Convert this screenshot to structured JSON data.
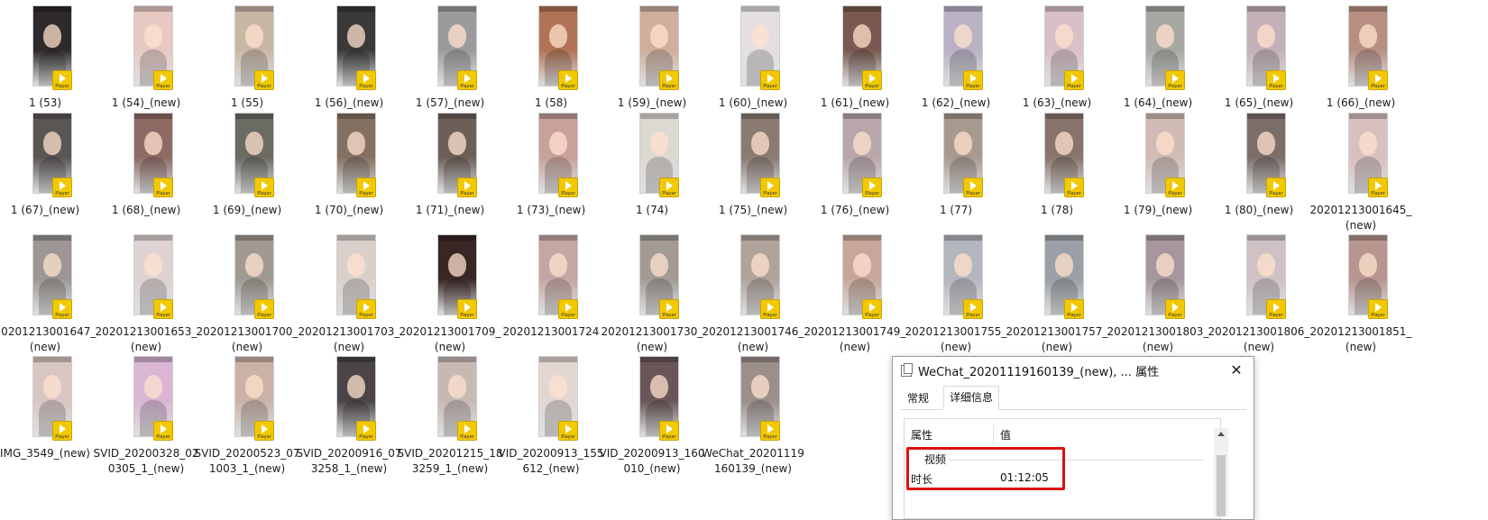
{
  "files": [
    {
      "name": "1 (53)",
      "thumb": "#2e2a2c"
    },
    {
      "name": "1 (54)_(new)",
      "thumb": "#e7c9c4"
    },
    {
      "name": "1 (55)",
      "thumb": "#c9b7a5"
    },
    {
      "name": "1 (56)_(new)",
      "thumb": "#3b3838"
    },
    {
      "name": "1 (57)_(new)",
      "thumb": "#9c9a9c"
    },
    {
      "name": "1 (58)",
      "thumb": "#b07355"
    },
    {
      "name": "1 (59)_(new)",
      "thumb": "#cfae9c"
    },
    {
      "name": "1 (60)_(new)",
      "thumb": "#e3dfe2"
    },
    {
      "name": "1 (61)_(new)",
      "thumb": "#7a5a50"
    },
    {
      "name": "1 (62)_(new)",
      "thumb": "#b9b2c4"
    },
    {
      "name": "1 (63)_(new)",
      "thumb": "#d8c0c6"
    },
    {
      "name": "1 (64)_(new)",
      "thumb": "#a7a7a3"
    },
    {
      "name": "1 (65)_(new)",
      "thumb": "#c4b0b8"
    },
    {
      "name": "1 (66)_(new)",
      "thumb": "#b88f82"
    },
    {
      "name": "1 (67)_(new)",
      "thumb": "#5a5654"
    },
    {
      "name": "1 (68)_(new)",
      "thumb": "#8e6a64"
    },
    {
      "name": "1 (69)_(new)",
      "thumb": "#6b6a63"
    },
    {
      "name": "1 (70)_(new)",
      "thumb": "#857161"
    },
    {
      "name": "1 (71)_(new)",
      "thumb": "#6c5f58"
    },
    {
      "name": "1 (73)_(new)",
      "thumb": "#c7a19a"
    },
    {
      "name": "1 (74)",
      "thumb": "#dcd8d2"
    },
    {
      "name": "1 (75)_(new)",
      "thumb": "#8a7a72"
    },
    {
      "name": "1 (76)_(new)",
      "thumb": "#b9a6ab"
    },
    {
      "name": "1 (77)",
      "thumb": "#a8998f"
    },
    {
      "name": "1 (78)",
      "thumb": "#88746b"
    },
    {
      "name": "1 (79)_(new)",
      "thumb": "#d1bcb5"
    },
    {
      "name": "1 (80)_(new)",
      "thumb": "#7b6e69"
    },
    {
      "name": "20201213001645_(new)",
      "thumb": "#d8bfc0"
    },
    {
      "name": "20201213001647_(new)",
      "thumb": "#9c9794"
    },
    {
      "name": "20201213001653_(new)",
      "thumb": "#ddd3d2"
    },
    {
      "name": "20201213001700_(new)",
      "thumb": "#a09a92"
    },
    {
      "name": "20201213001703_(new)",
      "thumb": "#d9d0cc"
    },
    {
      "name": "20201213001709_(new)",
      "thumb": "#3a2624"
    },
    {
      "name": "20201213001724",
      "thumb": "#c6a6a2"
    },
    {
      "name": "20201213001730_(new)",
      "thumb": "#a19b94"
    },
    {
      "name": "20201213001746_(new)",
      "thumb": "#b0a39c"
    },
    {
      "name": "20201213001749_(new)",
      "thumb": "#c7a79a"
    },
    {
      "name": "20201213001755_(new)",
      "thumb": "#b4b6bd"
    },
    {
      "name": "20201213001757_(new)",
      "thumb": "#9aa0a6"
    },
    {
      "name": "20201213001803_(new)",
      "thumb": "#a7969e"
    },
    {
      "name": "20201213001806_(new)",
      "thumb": "#cfc2c4"
    },
    {
      "name": "20201213001851_(new)",
      "thumb": "#b6968e"
    },
    {
      "name": "IMG_3549_(new)",
      "thumb": "#d8c6c3"
    },
    {
      "name": "SVID_20200328_020305_1_(new)",
      "thumb": "#d9b6d3"
    },
    {
      "name": "SVID_20200523_071003_1_(new)",
      "thumb": "#cbb2a6"
    },
    {
      "name": "SVID_20200916_073258_1_(new)",
      "thumb": "#4a4446"
    },
    {
      "name": "SVID_20201215_183259_1_(new)",
      "thumb": "#c6b9b4"
    },
    {
      "name": "VID_20200913_155612_(new)",
      "thumb": "#e2d7d2"
    },
    {
      "name": "VID_20200913_160010_(new)",
      "thumb": "#6a5658"
    },
    {
      "name": "WeChat_20201119160139_(new)",
      "thumb": "#9b8f8b"
    }
  ],
  "badge_text": "Player",
  "colors": {
    "badge": "#f2c900",
    "highlight": "#e01010"
  },
  "dialog": {
    "title": "WeChat_20201119160139_(new), ... 属性",
    "close_glyph": "✕",
    "tabs": [
      "常规",
      "详细信息"
    ],
    "active_tab": "详细信息",
    "columns": {
      "property": "属性",
      "value": "值"
    },
    "group": "视频",
    "rows": [
      {
        "name": "时长",
        "value": "01:12:05"
      }
    ]
  }
}
